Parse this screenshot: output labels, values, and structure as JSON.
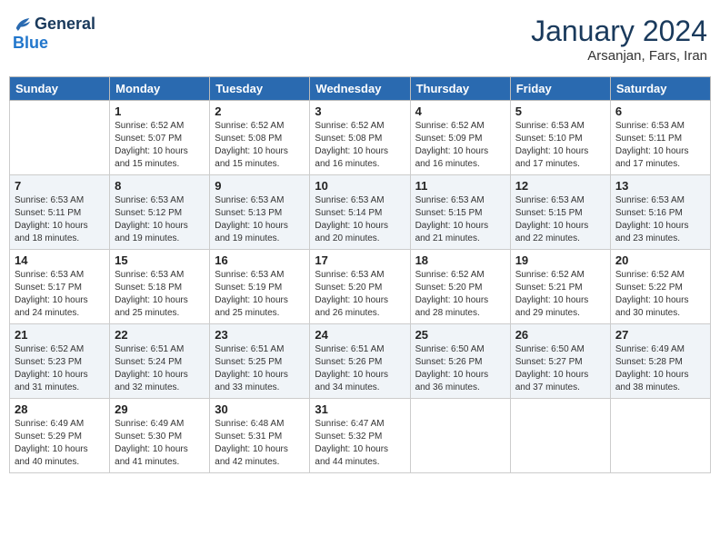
{
  "header": {
    "logo_general": "General",
    "logo_blue": "Blue",
    "month": "January 2024",
    "location": "Arsanjan, Fars, Iran"
  },
  "weekdays": [
    "Sunday",
    "Monday",
    "Tuesday",
    "Wednesday",
    "Thursday",
    "Friday",
    "Saturday"
  ],
  "weeks": [
    [
      {
        "day": "",
        "sunrise": "",
        "sunset": "",
        "daylight": ""
      },
      {
        "day": "1",
        "sunrise": "Sunrise: 6:52 AM",
        "sunset": "Sunset: 5:07 PM",
        "daylight": "Daylight: 10 hours and 15 minutes."
      },
      {
        "day": "2",
        "sunrise": "Sunrise: 6:52 AM",
        "sunset": "Sunset: 5:08 PM",
        "daylight": "Daylight: 10 hours and 15 minutes."
      },
      {
        "day": "3",
        "sunrise": "Sunrise: 6:52 AM",
        "sunset": "Sunset: 5:08 PM",
        "daylight": "Daylight: 10 hours and 16 minutes."
      },
      {
        "day": "4",
        "sunrise": "Sunrise: 6:52 AM",
        "sunset": "Sunset: 5:09 PM",
        "daylight": "Daylight: 10 hours and 16 minutes."
      },
      {
        "day": "5",
        "sunrise": "Sunrise: 6:53 AM",
        "sunset": "Sunset: 5:10 PM",
        "daylight": "Daylight: 10 hours and 17 minutes."
      },
      {
        "day": "6",
        "sunrise": "Sunrise: 6:53 AM",
        "sunset": "Sunset: 5:11 PM",
        "daylight": "Daylight: 10 hours and 17 minutes."
      }
    ],
    [
      {
        "day": "7",
        "sunrise": "Sunrise: 6:53 AM",
        "sunset": "Sunset: 5:11 PM",
        "daylight": "Daylight: 10 hours and 18 minutes."
      },
      {
        "day": "8",
        "sunrise": "Sunrise: 6:53 AM",
        "sunset": "Sunset: 5:12 PM",
        "daylight": "Daylight: 10 hours and 19 minutes."
      },
      {
        "day": "9",
        "sunrise": "Sunrise: 6:53 AM",
        "sunset": "Sunset: 5:13 PM",
        "daylight": "Daylight: 10 hours and 19 minutes."
      },
      {
        "day": "10",
        "sunrise": "Sunrise: 6:53 AM",
        "sunset": "Sunset: 5:14 PM",
        "daylight": "Daylight: 10 hours and 20 minutes."
      },
      {
        "day": "11",
        "sunrise": "Sunrise: 6:53 AM",
        "sunset": "Sunset: 5:15 PM",
        "daylight": "Daylight: 10 hours and 21 minutes."
      },
      {
        "day": "12",
        "sunrise": "Sunrise: 6:53 AM",
        "sunset": "Sunset: 5:15 PM",
        "daylight": "Daylight: 10 hours and 22 minutes."
      },
      {
        "day": "13",
        "sunrise": "Sunrise: 6:53 AM",
        "sunset": "Sunset: 5:16 PM",
        "daylight": "Daylight: 10 hours and 23 minutes."
      }
    ],
    [
      {
        "day": "14",
        "sunrise": "Sunrise: 6:53 AM",
        "sunset": "Sunset: 5:17 PM",
        "daylight": "Daylight: 10 hours and 24 minutes."
      },
      {
        "day": "15",
        "sunrise": "Sunrise: 6:53 AM",
        "sunset": "Sunset: 5:18 PM",
        "daylight": "Daylight: 10 hours and 25 minutes."
      },
      {
        "day": "16",
        "sunrise": "Sunrise: 6:53 AM",
        "sunset": "Sunset: 5:19 PM",
        "daylight": "Daylight: 10 hours and 25 minutes."
      },
      {
        "day": "17",
        "sunrise": "Sunrise: 6:53 AM",
        "sunset": "Sunset: 5:20 PM",
        "daylight": "Daylight: 10 hours and 26 minutes."
      },
      {
        "day": "18",
        "sunrise": "Sunrise: 6:52 AM",
        "sunset": "Sunset: 5:20 PM",
        "daylight": "Daylight: 10 hours and 28 minutes."
      },
      {
        "day": "19",
        "sunrise": "Sunrise: 6:52 AM",
        "sunset": "Sunset: 5:21 PM",
        "daylight": "Daylight: 10 hours and 29 minutes."
      },
      {
        "day": "20",
        "sunrise": "Sunrise: 6:52 AM",
        "sunset": "Sunset: 5:22 PM",
        "daylight": "Daylight: 10 hours and 30 minutes."
      }
    ],
    [
      {
        "day": "21",
        "sunrise": "Sunrise: 6:52 AM",
        "sunset": "Sunset: 5:23 PM",
        "daylight": "Daylight: 10 hours and 31 minutes."
      },
      {
        "day": "22",
        "sunrise": "Sunrise: 6:51 AM",
        "sunset": "Sunset: 5:24 PM",
        "daylight": "Daylight: 10 hours and 32 minutes."
      },
      {
        "day": "23",
        "sunrise": "Sunrise: 6:51 AM",
        "sunset": "Sunset: 5:25 PM",
        "daylight": "Daylight: 10 hours and 33 minutes."
      },
      {
        "day": "24",
        "sunrise": "Sunrise: 6:51 AM",
        "sunset": "Sunset: 5:26 PM",
        "daylight": "Daylight: 10 hours and 34 minutes."
      },
      {
        "day": "25",
        "sunrise": "Sunrise: 6:50 AM",
        "sunset": "Sunset: 5:26 PM",
        "daylight": "Daylight: 10 hours and 36 minutes."
      },
      {
        "day": "26",
        "sunrise": "Sunrise: 6:50 AM",
        "sunset": "Sunset: 5:27 PM",
        "daylight": "Daylight: 10 hours and 37 minutes."
      },
      {
        "day": "27",
        "sunrise": "Sunrise: 6:49 AM",
        "sunset": "Sunset: 5:28 PM",
        "daylight": "Daylight: 10 hours and 38 minutes."
      }
    ],
    [
      {
        "day": "28",
        "sunrise": "Sunrise: 6:49 AM",
        "sunset": "Sunset: 5:29 PM",
        "daylight": "Daylight: 10 hours and 40 minutes."
      },
      {
        "day": "29",
        "sunrise": "Sunrise: 6:49 AM",
        "sunset": "Sunset: 5:30 PM",
        "daylight": "Daylight: 10 hours and 41 minutes."
      },
      {
        "day": "30",
        "sunrise": "Sunrise: 6:48 AM",
        "sunset": "Sunset: 5:31 PM",
        "daylight": "Daylight: 10 hours and 42 minutes."
      },
      {
        "day": "31",
        "sunrise": "Sunrise: 6:47 AM",
        "sunset": "Sunset: 5:32 PM",
        "daylight": "Daylight: 10 hours and 44 minutes."
      },
      {
        "day": "",
        "sunrise": "",
        "sunset": "",
        "daylight": ""
      },
      {
        "day": "",
        "sunrise": "",
        "sunset": "",
        "daylight": ""
      },
      {
        "day": "",
        "sunrise": "",
        "sunset": "",
        "daylight": ""
      }
    ]
  ]
}
